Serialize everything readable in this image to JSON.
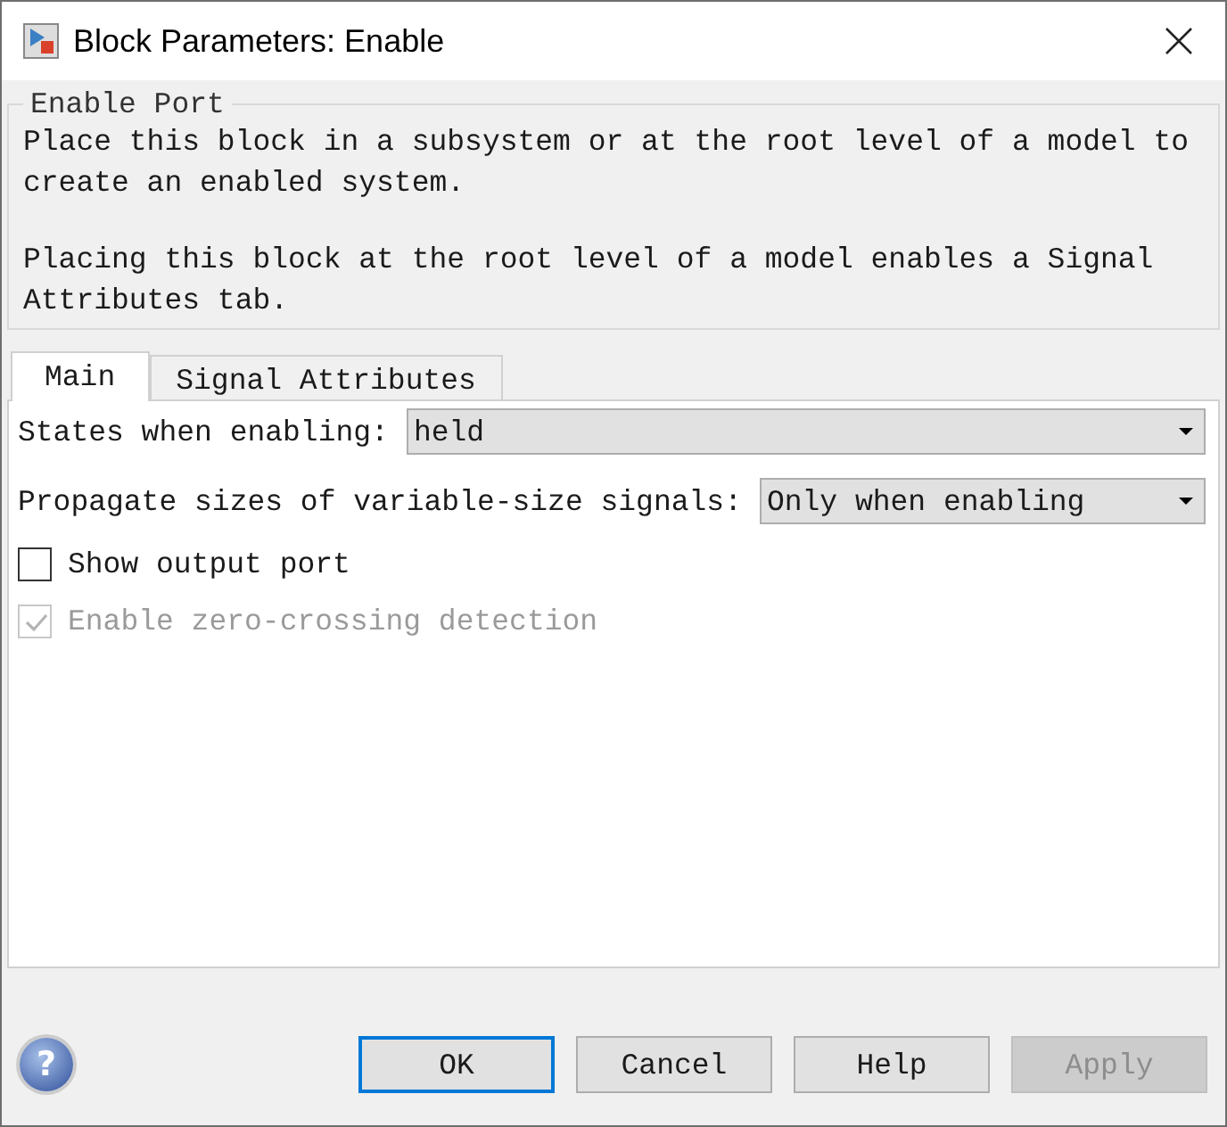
{
  "window": {
    "title": "Block Parameters: Enable"
  },
  "group": {
    "title": "Enable Port",
    "paragraphs": [
      "Place this block in a subsystem or at the root level of a model to create an enabled system.",
      "Placing this block at the root level of a model enables a Signal Attributes tab."
    ]
  },
  "tabs": [
    {
      "label": "Main",
      "selected": true
    },
    {
      "label": "Signal Attributes",
      "selected": false
    }
  ],
  "fields": [
    {
      "kind": "dropdown",
      "label": "States when enabling:",
      "value": "held"
    },
    {
      "kind": "dropdown",
      "label": "Propagate sizes of variable-size signals:",
      "value": "Only when enabling"
    },
    {
      "kind": "checkbox",
      "label": "Show output port",
      "checked": false,
      "disabled": false
    },
    {
      "kind": "checkbox",
      "label": "Enable zero-crossing detection",
      "checked": true,
      "disabled": true
    }
  ],
  "help_button": {
    "glyph": "?"
  },
  "buttons": [
    {
      "label": "OK",
      "focused": true,
      "disabled": false
    },
    {
      "label": "Cancel",
      "focused": false,
      "disabled": false
    },
    {
      "label": "Help",
      "focused": false,
      "disabled": false
    },
    {
      "label": "Apply",
      "focused": false,
      "disabled": true
    }
  ]
}
